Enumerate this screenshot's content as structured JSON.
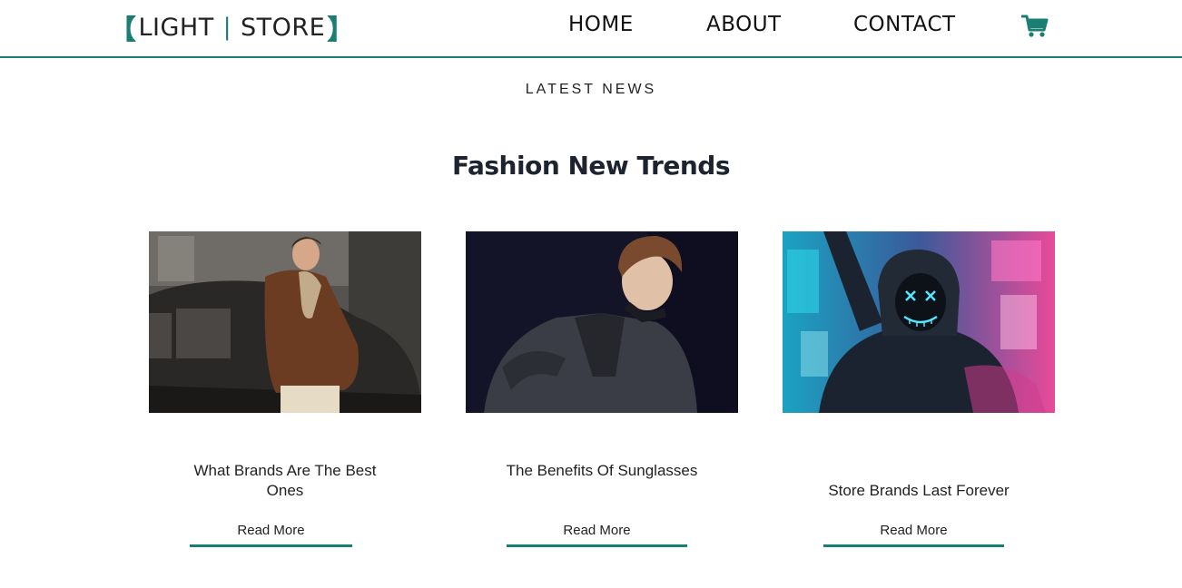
{
  "brand": {
    "bracket_left": "【",
    "word1": "LIGHT",
    "separator": "|",
    "word2": "STORE",
    "bracket_right": "】"
  },
  "nav": [
    {
      "label": "HOME"
    },
    {
      "label": "ABOUT"
    },
    {
      "label": "CONTACT"
    }
  ],
  "icons": {
    "cart": "shopping-cart-icon"
  },
  "colors": {
    "accent": "#1a7f72",
    "text": "#222222"
  },
  "section": {
    "label": "LATEST NEWS",
    "title": "Fashion New Trends"
  },
  "cards": [
    {
      "title": "What Brands Are The Best Ones",
      "link": "Read More",
      "image": "man-in-brown-jacket-by-vintage-car"
    },
    {
      "title": "The Benefits Of Sunglasses",
      "link": "Read More",
      "image": "young-man-in-dark-coat"
    },
    {
      "title": "Store Brands Last Forever",
      "link": "Read More",
      "image": "hooded-figure-with-neon-mask"
    }
  ]
}
